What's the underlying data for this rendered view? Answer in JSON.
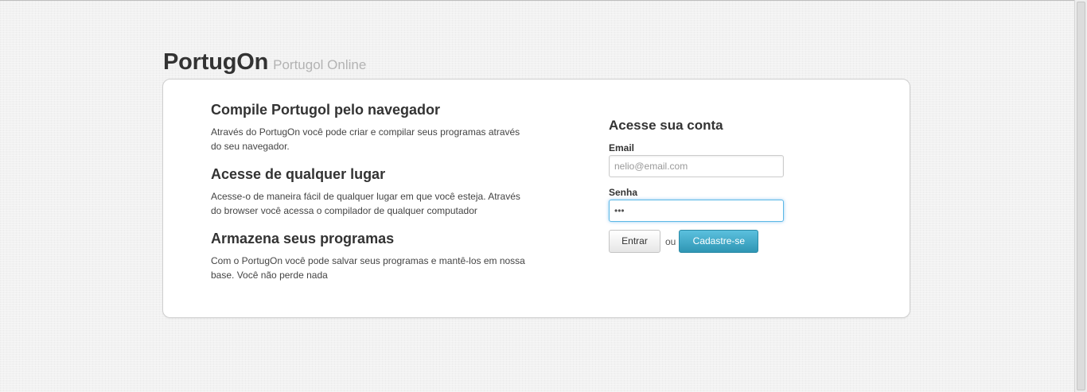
{
  "header": {
    "brand": "PortugOn",
    "tagline": "Portugol Online"
  },
  "features": [
    {
      "title": "Compile Portugol pelo navegador",
      "description": "Através do PortugOn você pode criar e compilar seus programas através do seu navegador."
    },
    {
      "title": "Acesse de qualquer lugar",
      "description": "Acesse-o de maneira fácil de qualquer lugar em que você esteja. Através do browser você acessa o compilador de qualquer computador"
    },
    {
      "title": "Armazena seus programas",
      "description": "Com o PortugOn você pode salvar seus programas e mantê-los em nossa base. Você não perde nada"
    }
  ],
  "login": {
    "title": "Acesse sua conta",
    "email_label": "Email",
    "email_placeholder": "nelio@email.com",
    "password_label": "Senha",
    "password_value": "•••",
    "submit_label": "Entrar",
    "or_text": "ou",
    "signup_label": "Cadastre-se"
  },
  "colors": {
    "background": "#f2f2f2",
    "panel": "#ffffff",
    "accent": "#49afcd",
    "focus_border": "#5cb8e6",
    "tagline": "#b3b3b3"
  }
}
